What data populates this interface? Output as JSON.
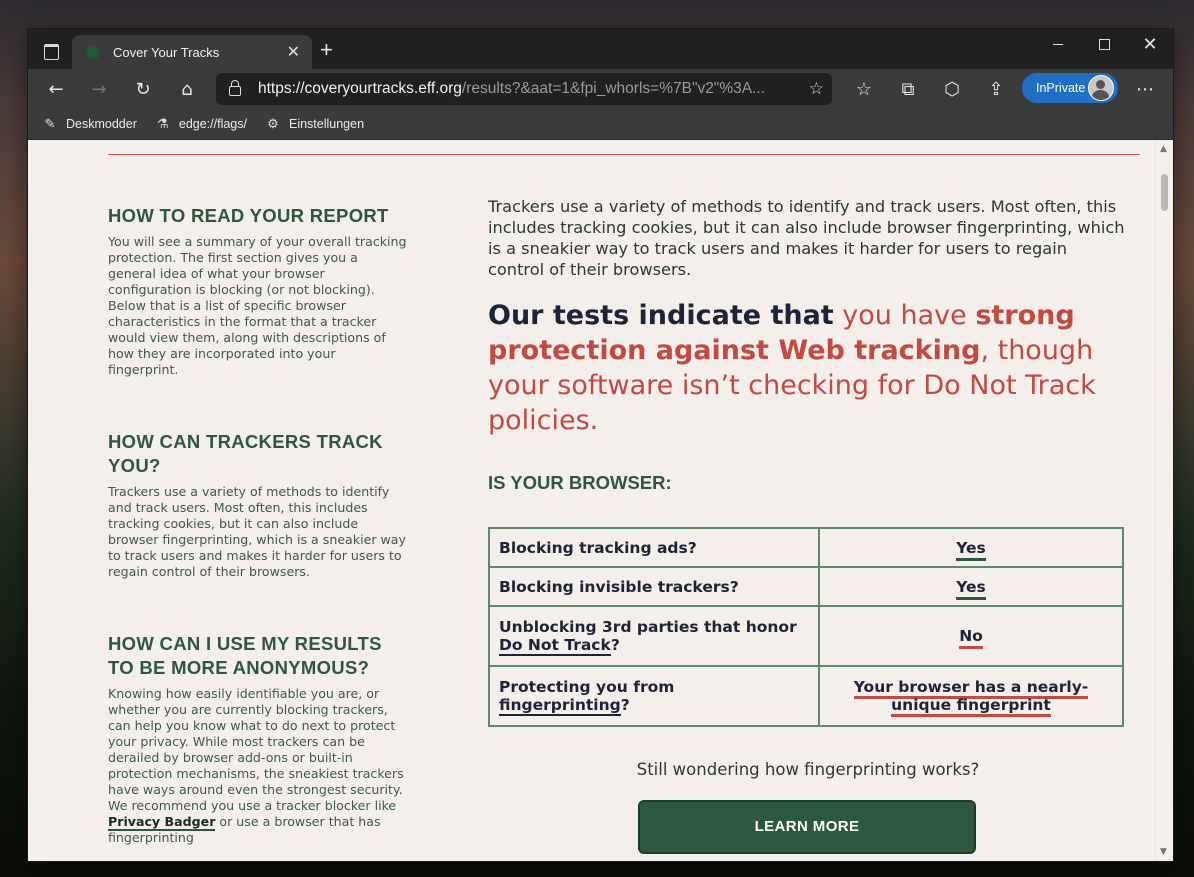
{
  "browser": {
    "tab_title": "Cover Your Tracks",
    "tab_close": "✕",
    "new_tab": "+",
    "url_host": "https://coveryourtracks.eff.org",
    "url_path": "/results?&aat=1&fpi_whorls=%7B\"v2\"%3A...",
    "inprivate_label": "InPrivate",
    "bookmarks": [
      {
        "label": "Deskmodder",
        "icon": "pen-icon"
      },
      {
        "label": "edge://flags/",
        "icon": "flask-icon"
      },
      {
        "label": "Einstellungen",
        "icon": "gear-icon"
      }
    ],
    "colors": {
      "chrome": "#3b3b3b",
      "inprivate": "#1f6fc5"
    }
  },
  "sidebar": {
    "sections": [
      {
        "title": "HOW TO READ YOUR REPORT",
        "text": "You will see a summary of your overall tracking protection. The first section gives you a general idea of what your browser configuration is blocking (or not blocking). Below that is a list of specific browser characteristics in the format that a tracker would view them, along with descriptions of how they are incorporated into your fingerprint."
      },
      {
        "title": "HOW CAN TRACKERS TRACK YOU?",
        "text": "Trackers use a variety of methods to identify and track users. Most often, this includes tracking cookies, but it can also include browser fingerprinting, which is a sneakier way to track users and makes it harder for users to regain control of their browsers."
      },
      {
        "title": "HOW CAN I USE MY RESULTS TO BE MORE ANONYMOUS?",
        "text_before": "Knowing how easily identifiable you are, or whether you are currently blocking trackers, can help you know what to do next to protect your privacy. While most trackers can be derailed by browser add-ons or built-in protection mechanisms, the sneakiest trackers have ways around even the strongest security. We recommend you use a tracker blocker like",
        "link": "Privacy Badger",
        "text_after": "or use a browser that has fingerprinting"
      }
    ]
  },
  "main": {
    "intro": "Trackers use a variety of methods to identify and track users. Most often, this includes tracking cookies, but it can also include browser fingerprinting, which is a sneakier way to track users and makes it harder for users to regain control of their browsers.",
    "headline": {
      "dark": "Our tests indicate that",
      "part1": " you have ",
      "strong": "strong protection against Web tracking",
      "part2": ", though your software isn’t checking for Do Not Track policies."
    },
    "browser_heading": "IS YOUR BROWSER:",
    "rows": [
      {
        "question": "Blocking tracking ads?",
        "answer": "Yes"
      },
      {
        "question": "Blocking invisible trackers?",
        "answer": "Yes"
      },
      {
        "question_before": "Unblocking 3rd parties that honor",
        "question_link": "Do Not Track",
        "question_after": "?",
        "answer": "No"
      },
      {
        "question_before": "Protecting you from",
        "question_link": "fingerprinting",
        "question_after": "?",
        "answer": "Your browser has a nearly-unique fingerprint"
      }
    ],
    "still_wondering": "Still wondering how fingerprinting works?",
    "learn_more": "LEARN MORE",
    "colors": {
      "green": "#2f5740",
      "red": "#c24a42",
      "bg": "#f4efeb"
    }
  }
}
